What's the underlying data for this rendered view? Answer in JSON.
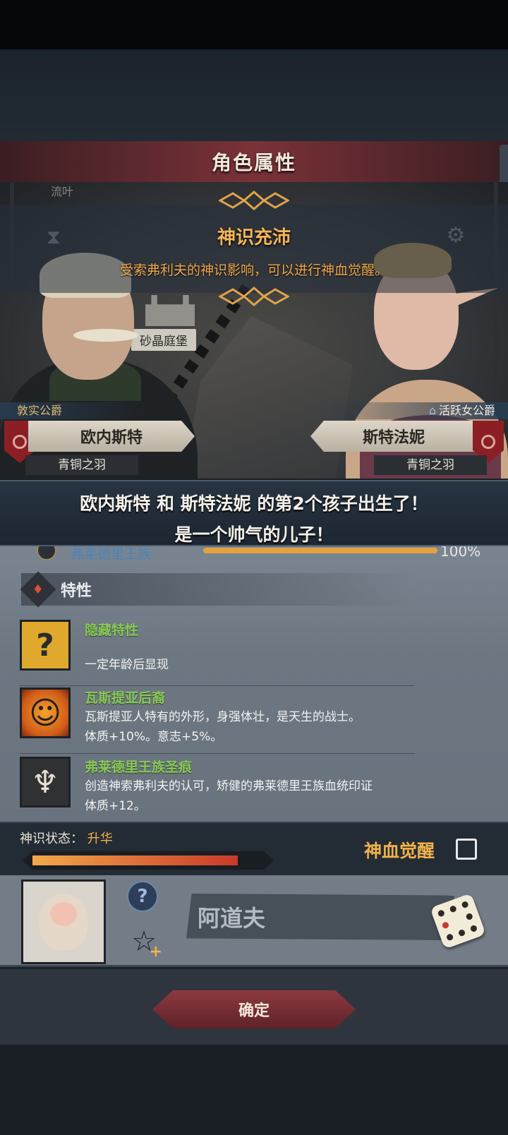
{
  "panel": {
    "title": "角色属性"
  },
  "scene": {
    "top_text": "流叶",
    "place_label": "砂晶庭堡"
  },
  "banner": {
    "title": "神识充沛",
    "description": "受索弗利夫的神识影响，可以进行神血觉醒。"
  },
  "father": {
    "title": "敦实公爵",
    "name": "欧内斯特",
    "house": "青铜之羽"
  },
  "mother": {
    "title": "活跃女公爵",
    "name": "斯特法妮",
    "house": "青铜之羽"
  },
  "announcement": {
    "line1": "欧内斯特 和 斯特法妮 的第2个孩子出生了！",
    "line2": "是一个帅气的儿子！"
  },
  "clan": {
    "name": "弗莱德里王族",
    "percent_label": "100%",
    "fill": 1.0
  },
  "traits_section": {
    "label": "特性"
  },
  "traits": [
    {
      "name": "隐藏特性",
      "icon": "question-icon",
      "desc1": "",
      "desc2": "一定年龄后显现"
    },
    {
      "name": "瓦斯提亚后裔",
      "icon": "smiling-sun-icon",
      "desc1": "瓦斯提亚人特有的外形，身强体壮，是天生的战士。",
      "desc2": "体质+10%。意志+5%。"
    },
    {
      "name": "弗莱德里王族圣痕",
      "icon": "stigmata-icon",
      "desc1": "创造神索弗利夫的认可，矫健的弗莱德里王族血统印证",
      "desc2": "体质+12。"
    }
  ],
  "divine_status": {
    "label": "神识状态：",
    "value": "升华",
    "fill": 0.93,
    "awaken_label": "神血觉醒",
    "awaken_checked": false
  },
  "naming": {
    "child_name": "阿道夫"
  },
  "confirm": {
    "label": "确定"
  },
  "colors": {
    "title_bar": "#7a3238",
    "banner_text": "#f3b556",
    "trait_name": "#89c85b",
    "status_value": "#f0b24a",
    "confirm_button": "#8c3a40"
  }
}
